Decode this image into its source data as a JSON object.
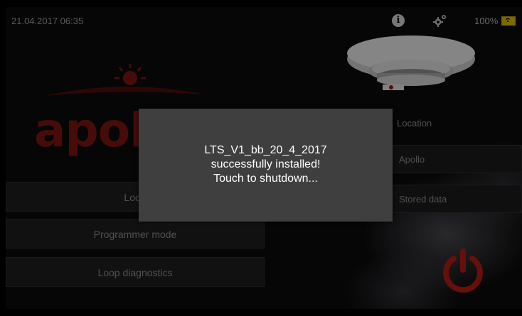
{
  "status_bar": {
    "datetime": "21.04.2017 06:35",
    "battery": "100%"
  },
  "logo": {
    "text": "apollo"
  },
  "menu": {
    "loop": "Loop",
    "programmer": "Programmer mode",
    "diagnostics": "Loop diagnostics"
  },
  "right_panel": {
    "location_label": "Location",
    "location_value": "Apollo",
    "stored_data": "Stored data"
  },
  "modal": {
    "line1": "LTS_V1_bb_20_4_2017",
    "line2": "successfully installed!",
    "line3": "Touch to shutdown..."
  },
  "colors": {
    "brand": "#7a1512",
    "power": "#b01a14",
    "battery": "#d8b700"
  },
  "icons": [
    "info-icon",
    "gear-icon",
    "battery-icon",
    "power-icon"
  ]
}
